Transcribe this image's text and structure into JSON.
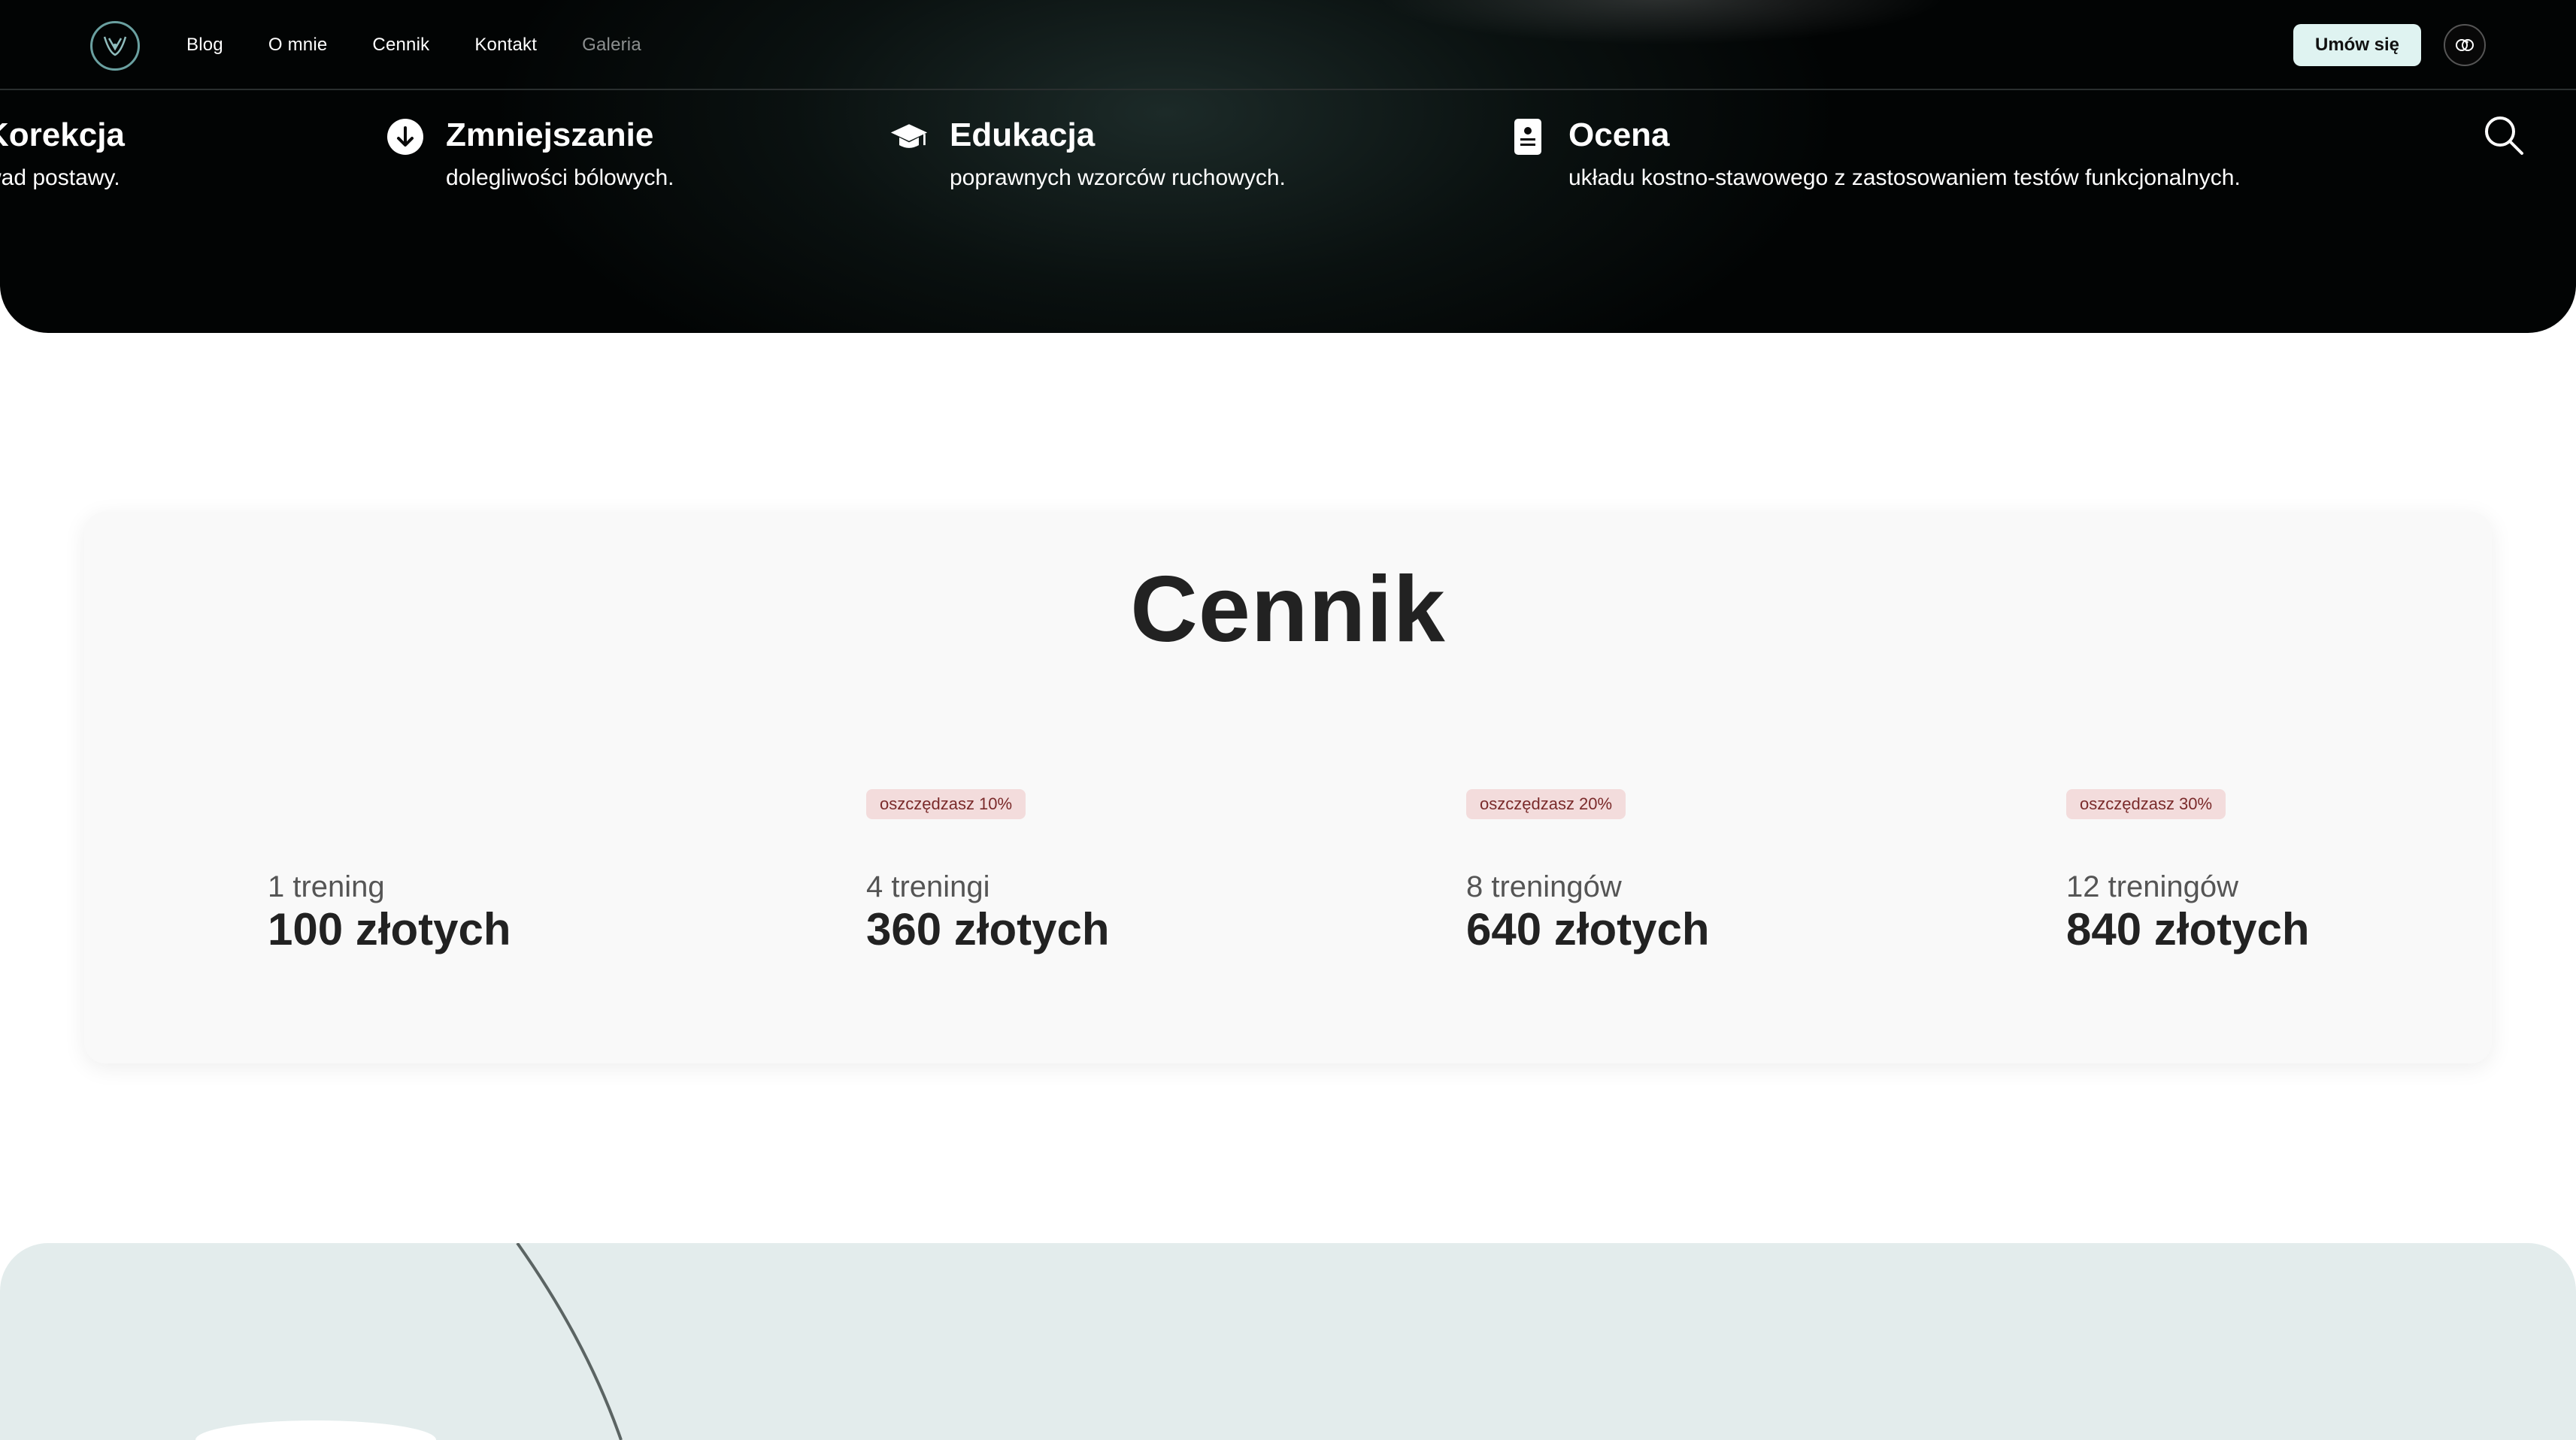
{
  "nav": {
    "links": [
      "Blog",
      "O mnie",
      "Cennik",
      "Kontakt",
      "Galeria"
    ],
    "cta_label": "Umów się",
    "logo_icon": "logo-icon",
    "a11y_icon": "accessibility-icon"
  },
  "features": [
    {
      "title": "Korekcja",
      "desc": "wad postawy.",
      "icon": ""
    },
    {
      "title": "Zmniejszanie",
      "desc": "dolegliwości bólowych.",
      "icon": "arrow-down-circle-icon"
    },
    {
      "title": "Edukacja",
      "desc": "poprawnych wzorców ruchowych.",
      "icon": "graduation-cap-icon"
    },
    {
      "title": "Ocena",
      "desc": "układu kostno-stawowego z zastosowaniem testów funkcjonalnych.",
      "icon": "clipboard-icon"
    }
  ],
  "search_icon": "search-icon",
  "pricing": {
    "title": "Cennik",
    "tiers": [
      {
        "badge": "",
        "label": "1 trening",
        "price": "100 złotych"
      },
      {
        "badge": "oszczędzasz 10%",
        "label": "4 treningi",
        "price": "360 złotych"
      },
      {
        "badge": "oszczędzasz 20%",
        "label": "8 treningów",
        "price": "640 złotych"
      },
      {
        "badge": "oszczędzasz 30%",
        "label": "12 treningów",
        "price": "840 złotych"
      }
    ]
  },
  "colors": {
    "hero_bg": "#020404",
    "cta_bg": "#dff3f1",
    "badge_bg": "#f3dcdc",
    "badge_text": "#7a2a2a",
    "card_bg": "#f9f9f9",
    "bottom_bg": "#e3ecec"
  }
}
